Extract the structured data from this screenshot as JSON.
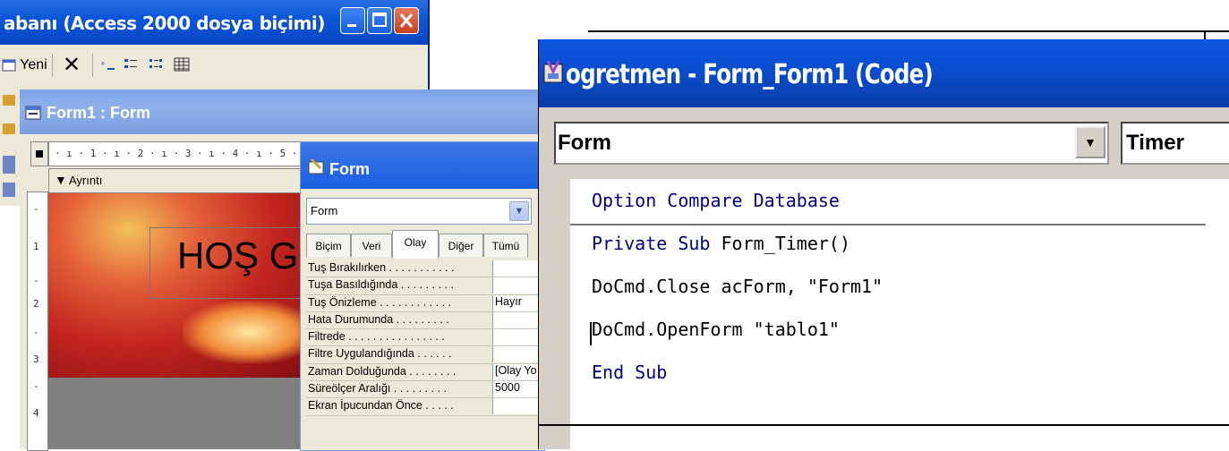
{
  "db_window": {
    "title": "abanı (Access 2000 dosya biçimi)",
    "toolbar": {
      "new_label": "Yeni",
      "delete_glyph": "✕"
    }
  },
  "form_window": {
    "title": "Form1 : Form",
    "ruler_text": "· ı · 1 · ı · 2 · ı · 3 · ı · 4 · ı · 5 · ı",
    "vruler_marks": [
      "-",
      "1",
      "-",
      "2",
      "-",
      "3",
      "-",
      "4"
    ],
    "section_header": "Ayrıntı",
    "label_text": "HOŞ G"
  },
  "property_sheet": {
    "title": "Form",
    "object_select": "Form",
    "tabs": [
      "Biçim",
      "Veri",
      "Olay",
      "Diğer",
      "Tümü"
    ],
    "active_tab": "Olay",
    "rows": [
      {
        "label": "Tuş Bırakılırken . . . . . . . . . . .",
        "value": ""
      },
      {
        "label": "Tuşa Basıldığında . . . . . . . . .",
        "value": ""
      },
      {
        "label": "Tuş Önizleme . . . . . . . . . . . .",
        "value": "Hayır"
      },
      {
        "label": "Hata Durumunda . . . . . . . . .",
        "value": ""
      },
      {
        "label": "Filtrede . . . . . . . . . . . . . . . .",
        "value": ""
      },
      {
        "label": "Filtre Uygulandığında . . . . . .",
        "value": ""
      },
      {
        "label": "Zaman Dolduğunda . . . . . . . .",
        "value": "[Olay Yo"
      },
      {
        "label": "Süreölçer Aralığı . . . . . . . . .",
        "value": "5000"
      },
      {
        "label": "Ekran İpucundan Önce . . . . .",
        "value": ""
      }
    ]
  },
  "code_window": {
    "title": "ogretmen - Form_Form1 (Code)",
    "object_combo": "Form",
    "procedure_combo": "Timer",
    "lines": [
      {
        "kw": "Option Compare Database",
        "rest": ""
      },
      {
        "kw": "Private Sub",
        "rest": " Form_Timer()"
      },
      {
        "kw": "",
        "rest": "DoCmd.Close acForm, \"Form1\""
      },
      {
        "kw": "",
        "rest": "DoCmd.OpenForm \"tablo1\""
      },
      {
        "kw": "End Sub",
        "rest": ""
      }
    ]
  },
  "colors": {
    "xp_blue": "#0a56e0",
    "code_keyword": "#00007f",
    "face": "#ece9d8"
  }
}
